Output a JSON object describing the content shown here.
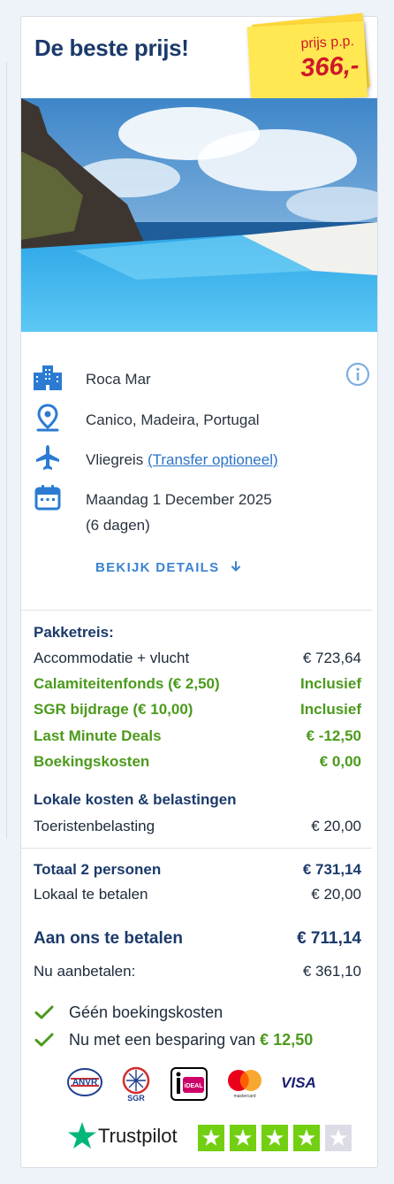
{
  "card": {
    "title": "De beste prijs!",
    "price_label": "prijs p.p.",
    "price_amount": "366,-"
  },
  "hotel": {
    "name": "Roca Mar",
    "location": "Canico, Madeira, Portugal",
    "travel_type": "Vliegreis",
    "transfer_link": "(Transfer optioneel)",
    "date": "Maandag 1 December 2025",
    "duration": "(6 dagen)",
    "details_label": "BEKIJK DETAILS"
  },
  "pricing": {
    "package_heading": "Pakketreis:",
    "items": [
      {
        "label": "Accommodatie + vlucht",
        "value": "€ 723,64"
      },
      {
        "label": "Calamiteitenfonds (€ 2,50)",
        "value": "Inclusief"
      },
      {
        "label": "SGR bijdrage (€ 10,00)",
        "value": "Inclusief"
      },
      {
        "label": "Last Minute Deals",
        "value": "€ -12,50"
      },
      {
        "label": "Boekingskosten",
        "value": "€ 0,00"
      }
    ],
    "local_heading": "Lokale kosten & belastingen",
    "tourist_tax_label": "Toeristenbelasting",
    "tourist_tax_value": "€ 20,00",
    "total_label": "Totaal 2 personen",
    "total_value": "€ 731,14",
    "local_pay_label": "Lokaal te betalen",
    "local_pay_value": "€ 20,00",
    "pay_us_label": "Aan ons te betalen",
    "pay_us_value": "€ 711,14",
    "deposit_label": "Nu aanbetalen:",
    "deposit_value": "€ 361,10"
  },
  "usps": {
    "no_fees": "Géén boekingskosten",
    "saving_text": "Nu met een besparing van",
    "saving_amount": "€ 12,50"
  },
  "trust": {
    "logos": [
      "anvr-logo",
      "sgr-logo",
      "ideal-logo",
      "mastercard-logo",
      "visa-logo"
    ],
    "anvr": "ANVR",
    "sgr": "SGR",
    "ideal": "iDEAL",
    "mastercard": "mastercard",
    "visa": "VISA",
    "trustpilot": "Trustpilot",
    "rating_stars": 4,
    "max_stars": 5
  },
  "colors": {
    "navy": "#1b3a6b",
    "blue": "#3a83d1",
    "green": "#4c9a1c",
    "price_red": "#d0162a",
    "sticker_yellow": "#ffe851",
    "trustpilot_green": "#00b67a"
  }
}
